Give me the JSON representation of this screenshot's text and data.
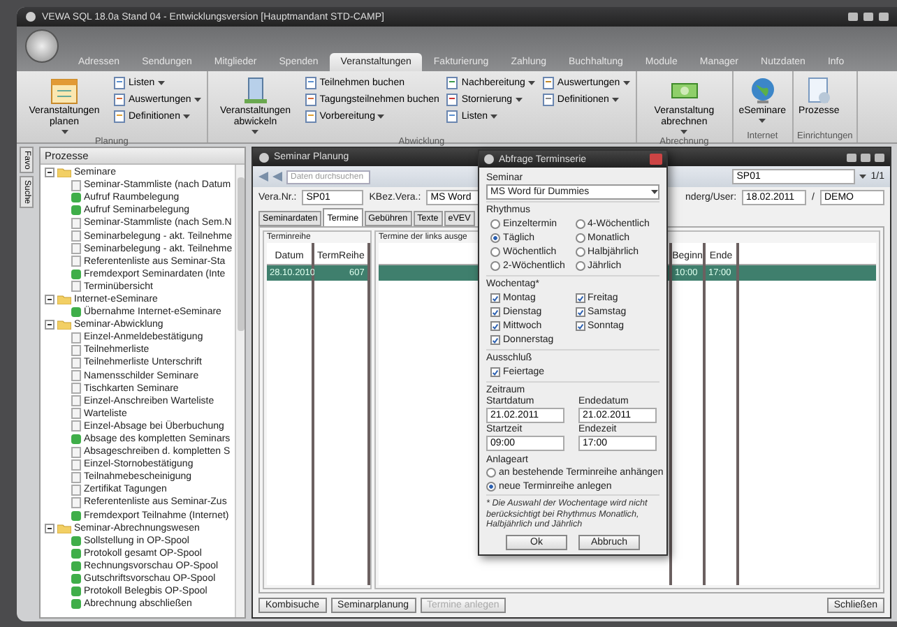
{
  "window": {
    "title": "VEWA SQL 18.0a Stand 04 - Entwicklungsversion [Hauptmandant STD-CAMP]"
  },
  "ribbon_tabs": [
    {
      "label": "Adressen",
      "selected": false
    },
    {
      "label": "Sendungen",
      "selected": false
    },
    {
      "label": "Mitglieder",
      "selected": false
    },
    {
      "label": "Spenden",
      "selected": false
    },
    {
      "label": "Veranstaltungen",
      "selected": true
    },
    {
      "label": "Fakturierung",
      "selected": false
    },
    {
      "label": "Zahlung",
      "selected": false
    },
    {
      "label": "Buchhaltung",
      "selected": false
    },
    {
      "label": "Module",
      "selected": false
    },
    {
      "label": "Manager",
      "selected": false
    },
    {
      "label": "Nutzdaten",
      "selected": false
    },
    {
      "label": "Info",
      "selected": false
    }
  ],
  "ribbon_groups": [
    {
      "title": "Planung",
      "large": [
        {
          "label": "Veranstaltungen planen",
          "dropdown": true
        }
      ],
      "small": [
        {
          "label": "Listen",
          "dropdown": true
        },
        {
          "label": "Auswertungen",
          "dropdown": true
        },
        {
          "label": "Definitionen",
          "dropdown": true
        }
      ]
    },
    {
      "title": "Abwicklung",
      "large": [
        {
          "label": "Veranstaltungen abwickeln",
          "dropdown": true
        }
      ],
      "small": [
        {
          "label": "Teilnehmen buchen",
          "dropdown": false
        },
        {
          "label": "Tagungsteilnehmen buchen",
          "dropdown": false
        },
        {
          "label": "Vorbereitung",
          "dropdown": true
        },
        {
          "label": "Nachbereitung",
          "dropdown": true
        },
        {
          "label": "Stornierung",
          "dropdown": true
        },
        {
          "label": "Listen",
          "dropdown": true
        },
        {
          "label": "Auswertungen",
          "dropdown": true
        },
        {
          "label": "Definitionen",
          "dropdown": true
        }
      ]
    },
    {
      "title": "Abrechnung",
      "large": [
        {
          "label": "Veranstaltung abrechnen",
          "dropdown": true
        }
      ]
    },
    {
      "title": "Internet",
      "large": [
        {
          "label": "eSeminare",
          "dropdown": true
        }
      ]
    },
    {
      "title": "Einrichtungen",
      "large": [
        {
          "label": "Prozesse",
          "dropdown": false
        }
      ]
    }
  ],
  "side_tabs": [
    "Favo",
    "Suche"
  ],
  "sidebar": {
    "title": "Prozesse",
    "tree": [
      {
        "label": "Seminare",
        "expanded": true,
        "children": [
          {
            "label": "Seminar-Stammliste (nach Datum",
            "kind": "document"
          },
          {
            "label": "Aufruf Raumbelegung",
            "kind": "process"
          },
          {
            "label": "Aufruf Seminarbelegung",
            "kind": "process"
          },
          {
            "label": "Seminar-Stammliste (nach Sem.N",
            "kind": "document"
          },
          {
            "label": "Seminarbelegung - akt. Teilnehme",
            "kind": "document"
          },
          {
            "label": "Seminarbelegung - akt. Teilnehme",
            "kind": "document"
          },
          {
            "label": "Referentenliste aus Seminar-Sta",
            "kind": "document"
          },
          {
            "label": "Fremdexport Seminardaten (Inte",
            "kind": "process"
          },
          {
            "label": "Terminübersicht",
            "kind": "document"
          }
        ]
      },
      {
        "label": "Internet-eSeminare",
        "expanded": true,
        "children": [
          {
            "label": "Übernahme Internet-eSeminare",
            "kind": "process"
          }
        ]
      },
      {
        "label": "Seminar-Abwicklung",
        "expanded": true,
        "children": [
          {
            "label": "Einzel-Anmeldebestätigung",
            "kind": "document"
          },
          {
            "label": "Teilnehmerliste",
            "kind": "document"
          },
          {
            "label": "Teilnehmerliste Unterschrift",
            "kind": "document"
          },
          {
            "label": "Namensschilder Seminare",
            "kind": "document"
          },
          {
            "label": "Tischkarten Seminare",
            "kind": "document"
          },
          {
            "label": "Einzel-Anschreiben Warteliste",
            "kind": "document"
          },
          {
            "label": "Warteliste",
            "kind": "document"
          },
          {
            "label": "Einzel-Absage bei Überbuchung",
            "kind": "document"
          },
          {
            "label": "Absage des kompletten Seminars",
            "kind": "process"
          },
          {
            "label": "Absageschreiben d. kompletten S",
            "kind": "document"
          },
          {
            "label": "Einzel-Stornobestätigung",
            "kind": "document"
          },
          {
            "label": "Teilnahmebescheinigung",
            "kind": "document"
          },
          {
            "label": "Zertifikat Tagungen",
            "kind": "document"
          },
          {
            "label": "Referentenliste aus Seminar-Zus",
            "kind": "document"
          },
          {
            "label": "Fremdexport Teilnahme (Internet)",
            "kind": "process"
          }
        ]
      },
      {
        "label": "Seminar-Abrechnungswesen",
        "expanded": true,
        "children": [
          {
            "label": "Sollstellung in OP-Spool",
            "kind": "process"
          },
          {
            "label": "Protokoll gesamt OP-Spool",
            "kind": "process"
          },
          {
            "label": "Rechnungsvorschau OP-Spool",
            "kind": "process"
          },
          {
            "label": "Gutschriftsvorschau OP-Spool",
            "kind": "process"
          },
          {
            "label": "Protokoll Belegbis OP-Spool",
            "kind": "process"
          },
          {
            "label": "Abrechnung abschließen",
            "kind": "process"
          }
        ]
      }
    ]
  },
  "planning_window": {
    "title": "Seminar Planung",
    "search": {
      "placeholder": "Daten durchsuchen"
    },
    "record_field": "SP01",
    "record_counter": "1/1",
    "fields": [
      {
        "label": "Vera.Nr.:",
        "value": "SP01"
      },
      {
        "label": "KBez.Vera.:",
        "value": "MS Word"
      }
    ],
    "change_label": "nderg/User:",
    "change_date": "18.02.2011",
    "separator": "/",
    "change_user": "DEMO",
    "tabs": [
      {
        "label": "Seminardaten",
        "selected": false
      },
      {
        "label": "Termine",
        "selected": true
      },
      {
        "label": "Gebühren",
        "selected": false
      },
      {
        "label": "Texte",
        "selected": false
      },
      {
        "label": "eVEV",
        "selected": false
      }
    ],
    "series_panel": {
      "title": "Terminreihe",
      "columns": [
        "Datum",
        "TermReihe"
      ],
      "rows": [
        {
          "cells": [
            "28.10.2010",
            "607"
          ],
          "selected": true
        }
      ]
    },
    "dates_panel": {
      "title": "Termine der links ausge",
      "columns": [
        "Beginn",
        "Ende"
      ],
      "rows": [
        {
          "cells": [
            "10:00",
            "17:00"
          ],
          "selected": true
        }
      ]
    },
    "buttons": [
      {
        "label": "Kombisuche",
        "disabled": false
      },
      {
        "label": "Seminarplanung",
        "disabled": false
      },
      {
        "label": "Termine anlegen",
        "disabled": true
      }
    ],
    "close_button": "Schließen"
  },
  "dialog": {
    "title": "Abfrage Terminserie",
    "seminar_label": "Seminar",
    "seminar_value": "MS Word für Dummies",
    "rhythm_label": "Rhythmus",
    "rhythm": [
      {
        "label": "Einzeltermin",
        "selected": false
      },
      {
        "label": "Täglich",
        "selected": true
      },
      {
        "label": "Wöchentlich",
        "selected": false
      },
      {
        "label": "2-Wöchentlich",
        "selected": false
      },
      {
        "label": "4-Wöchentlich",
        "selected": false
      },
      {
        "label": "Monatlich",
        "selected": false
      },
      {
        "label": "Halbjährlich",
        "selected": false
      },
      {
        "label": "Jährlich",
        "selected": false
      }
    ],
    "weekday_label": "Wochentag*",
    "weekdays": [
      {
        "label": "Montag",
        "checked": true
      },
      {
        "label": "Dienstag",
        "checked": true
      },
      {
        "label": "Mittwoch",
        "checked": true
      },
      {
        "label": "Donnerstag",
        "checked": true
      },
      {
        "label": "Freitag",
        "checked": true
      },
      {
        "label": "Samstag",
        "checked": true
      },
      {
        "label": "Sonntag",
        "checked": true
      }
    ],
    "exclusion_label": "Ausschluß",
    "exclusions": [
      {
        "label": "Feiertage",
        "checked": true
      }
    ],
    "period_label": "Zeitraum",
    "period_fields": [
      {
        "label": "Startdatum",
        "value": "21.02.2011"
      },
      {
        "label": "Endedatum",
        "value": "21.02.2011"
      },
      {
        "label": "Startzeit",
        "value": "09:00"
      },
      {
        "label": "Endezeit",
        "value": "17:00"
      }
    ],
    "mode_label": "Anlageart",
    "modes": [
      {
        "label": "an bestehende Terminreihe anhängen",
        "selected": false
      },
      {
        "label": "neue Terminreihe anlegen",
        "selected": true
      }
    ],
    "note": "* Die Auswahl der Wochentage wird nicht berücksichtigt bei Rhythmus Monatlich, Halbjährlich und Jährlich",
    "buttons": [
      "Ok",
      "Abbruch"
    ]
  }
}
